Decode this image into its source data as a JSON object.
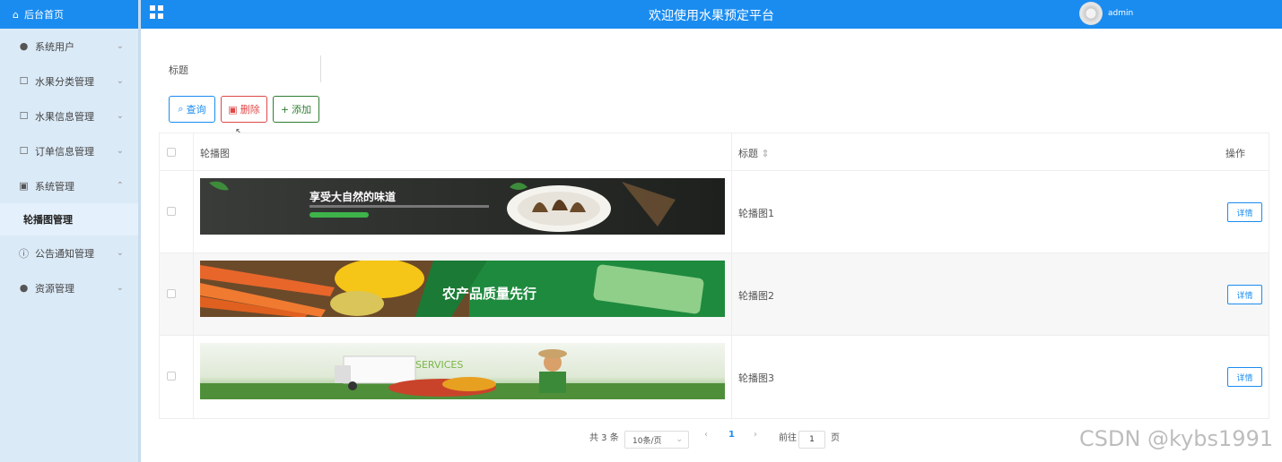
{
  "sidebar": {
    "home_label": "后台首页",
    "items": [
      {
        "label": "系统用户",
        "icon": "user-icon"
      },
      {
        "label": "水果分类管理",
        "icon": "doc-icon"
      },
      {
        "label": "水果信息管理",
        "icon": "doc-icon"
      },
      {
        "label": "订单信息管理",
        "icon": "doc-icon"
      },
      {
        "label": "系统管理",
        "icon": "image-icon"
      },
      {
        "label": "公告通知管理",
        "icon": "info-icon"
      },
      {
        "label": "资源管理",
        "icon": "location-icon"
      }
    ],
    "active_sub": "轮播图管理"
  },
  "header": {
    "title": "欢迎使用水果预定平台",
    "user": "admin"
  },
  "search": {
    "label": "标题"
  },
  "toolbar": {
    "query": "查询",
    "delete": "删除",
    "add": "添加"
  },
  "table": {
    "headers": {
      "image": "轮播图",
      "title": "标题",
      "action": "操作"
    },
    "rows": [
      {
        "title": "轮播图1",
        "action": "详情",
        "banner_text": "享受大自然的味道"
      },
      {
        "title": "轮播图2",
        "action": "详情",
        "banner_text": "农产品质量先行"
      },
      {
        "title": "轮播图3",
        "action": "详情",
        "banner_text": "SERVICES"
      }
    ]
  },
  "pagination": {
    "total": "共 3 条",
    "page_size": "10条/页",
    "current": "1",
    "goto_label": "前往",
    "goto_value": "1",
    "page_unit": "页"
  },
  "watermark": "CSDN @kybs1991"
}
